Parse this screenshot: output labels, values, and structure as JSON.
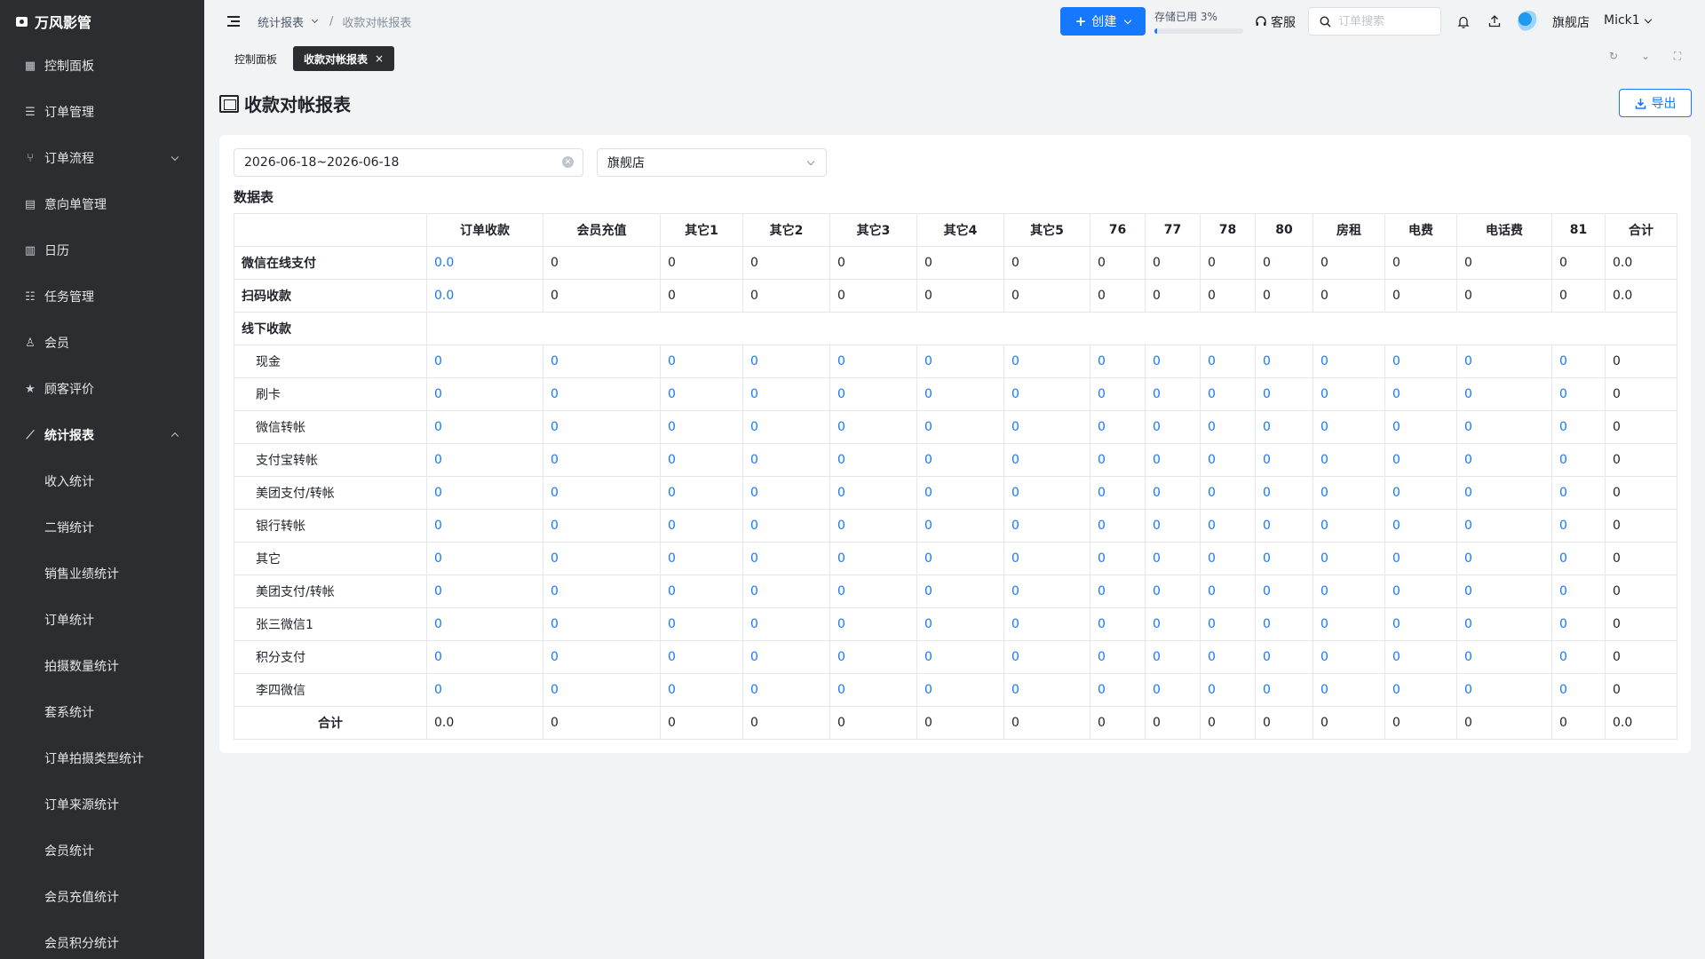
{
  "app": {
    "name": "万风影管"
  },
  "sidebar": {
    "items": [
      {
        "label": "控制面板",
        "icon": "grid-icon"
      },
      {
        "label": "订单管理",
        "icon": "list-icon"
      },
      {
        "label": "订单流程",
        "icon": "flow-icon"
      },
      {
        "label": "意向单管理",
        "icon": "doc-icon"
      },
      {
        "label": "日历",
        "icon": "calendar-icon"
      },
      {
        "label": "任务管理",
        "icon": "tasks-icon"
      },
      {
        "label": "会员",
        "icon": "user-icon"
      },
      {
        "label": "顾客评价",
        "icon": "star-icon"
      },
      {
        "label": "统计报表",
        "icon": "chart-icon"
      }
    ],
    "sub_items": [
      "收入统计",
      "二销统计",
      "销售业绩统计",
      "订单统计",
      "拍摄数量统计",
      "套系统计",
      "订单拍摄类型统计",
      "订单来源统计",
      "会员统计",
      "会员充值统计",
      "会员积分统计"
    ]
  },
  "header": {
    "breadcrumb_parent": "统计报表",
    "breadcrumb_sep": "/",
    "breadcrumb_current": "收款对帐报表",
    "create_label": "创建",
    "storage_label": "存储已用 3%",
    "storage_percent": 3,
    "support_label": "客服",
    "search_placeholder": "订单搜索",
    "shop_name": "旗舰店",
    "user_name": "Mick1"
  },
  "tabs": [
    {
      "label": "控制面板"
    },
    {
      "label": "收款对帐报表",
      "close": "×"
    }
  ],
  "page": {
    "title": "收款对帐报表",
    "export_label": "导出",
    "date_range": "2026-06-18~2026-06-18",
    "store": "旗舰店",
    "section_title": "数据表"
  },
  "table": {
    "columns": [
      "订单收款",
      "会员充值",
      "其它1",
      "其它2",
      "其它3",
      "其它4",
      "其它5",
      "76",
      "77",
      "78",
      "80",
      "房租",
      "电费",
      "电话费",
      "81",
      "合计"
    ],
    "rows": [
      {
        "label": "微信在线支付",
        "type": "main",
        "values": [
          "0.0",
          "0",
          "0",
          "0",
          "0",
          "0",
          "0",
          "0",
          "0",
          "0",
          "0",
          "0",
          "0",
          "0",
          "0",
          "0.0"
        ],
        "link_cols": [
          0
        ]
      },
      {
        "label": "扫码收款",
        "type": "main",
        "values": [
          "0.0",
          "0",
          "0",
          "0",
          "0",
          "0",
          "0",
          "0",
          "0",
          "0",
          "0",
          "0",
          "0",
          "0",
          "0",
          "0.0"
        ],
        "link_cols": [
          0
        ]
      },
      {
        "label": "线下收款",
        "type": "group",
        "values": []
      },
      {
        "label": "现金",
        "type": "sub",
        "values": [
          "0",
          "0",
          "0",
          "0",
          "0",
          "0",
          "0",
          "0",
          "0",
          "0",
          "0",
          "0",
          "0",
          "0",
          "0",
          "0"
        ]
      },
      {
        "label": "刷卡",
        "type": "sub",
        "values": [
          "0",
          "0",
          "0",
          "0",
          "0",
          "0",
          "0",
          "0",
          "0",
          "0",
          "0",
          "0",
          "0",
          "0",
          "0",
          "0"
        ]
      },
      {
        "label": "微信转帐",
        "type": "sub",
        "values": [
          "0",
          "0",
          "0",
          "0",
          "0",
          "0",
          "0",
          "0",
          "0",
          "0",
          "0",
          "0",
          "0",
          "0",
          "0",
          "0"
        ]
      },
      {
        "label": "支付宝转帐",
        "type": "sub",
        "values": [
          "0",
          "0",
          "0",
          "0",
          "0",
          "0",
          "0",
          "0",
          "0",
          "0",
          "0",
          "0",
          "0",
          "0",
          "0",
          "0"
        ]
      },
      {
        "label": "美团支付/转帐",
        "type": "sub",
        "values": [
          "0",
          "0",
          "0",
          "0",
          "0",
          "0",
          "0",
          "0",
          "0",
          "0",
          "0",
          "0",
          "0",
          "0",
          "0",
          "0"
        ]
      },
      {
        "label": "银行转帐",
        "type": "sub",
        "values": [
          "0",
          "0",
          "0",
          "0",
          "0",
          "0",
          "0",
          "0",
          "0",
          "0",
          "0",
          "0",
          "0",
          "0",
          "0",
          "0"
        ]
      },
      {
        "label": "其它",
        "type": "sub",
        "values": [
          "0",
          "0",
          "0",
          "0",
          "0",
          "0",
          "0",
          "0",
          "0",
          "0",
          "0",
          "0",
          "0",
          "0",
          "0",
          "0"
        ]
      },
      {
        "label": "美团支付/转帐",
        "type": "sub",
        "values": [
          "0",
          "0",
          "0",
          "0",
          "0",
          "0",
          "0",
          "0",
          "0",
          "0",
          "0",
          "0",
          "0",
          "0",
          "0",
          "0"
        ]
      },
      {
        "label": "张三微信1",
        "type": "sub",
        "values": [
          "0",
          "0",
          "0",
          "0",
          "0",
          "0",
          "0",
          "0",
          "0",
          "0",
          "0",
          "0",
          "0",
          "0",
          "0",
          "0"
        ]
      },
      {
        "label": "积分支付",
        "type": "sub",
        "values": [
          "0",
          "0",
          "0",
          "0",
          "0",
          "0",
          "0",
          "0",
          "0",
          "0",
          "0",
          "0",
          "0",
          "0",
          "0",
          "0"
        ]
      },
      {
        "label": "李四微信",
        "type": "sub",
        "values": [
          "0",
          "0",
          "0",
          "0",
          "0",
          "0",
          "0",
          "0",
          "0",
          "0",
          "0",
          "0",
          "0",
          "0",
          "0",
          "0"
        ]
      },
      {
        "label": "合计",
        "type": "total",
        "values": [
          "0.0",
          "0",
          "0",
          "0",
          "0",
          "0",
          "0",
          "0",
          "0",
          "0",
          "0",
          "0",
          "0",
          "0",
          "0",
          "0.0"
        ]
      }
    ]
  },
  "colors": {
    "primary": "#1677ff",
    "sidebar_bg": "#2b2d30",
    "page_bg": "#f2f3f5"
  }
}
